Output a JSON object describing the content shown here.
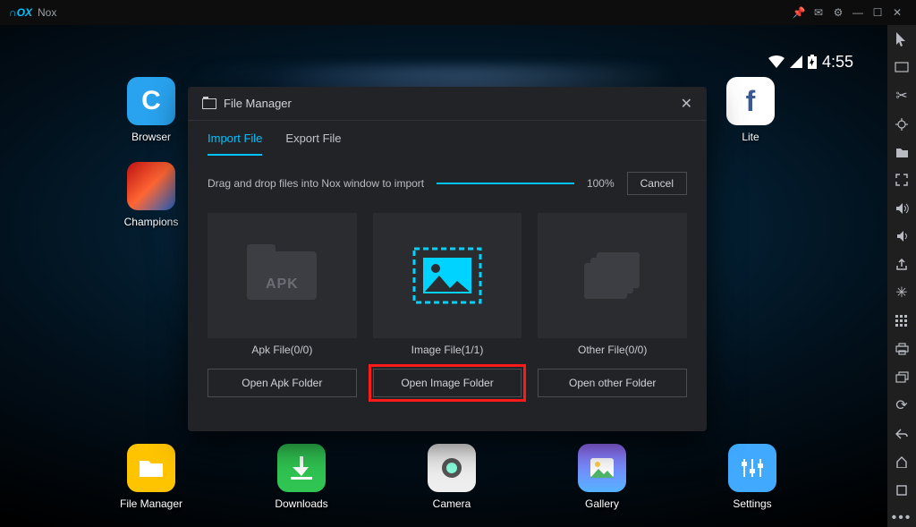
{
  "app": {
    "name": "Nox"
  },
  "status": {
    "time": "4:55"
  },
  "desktop": {
    "browser": "Browser",
    "lite": "Lite",
    "champions": "Champions",
    "filemgr": "File Manager",
    "downloads": "Downloads",
    "camera": "Camera",
    "gallery": "Gallery",
    "settings": "Settings"
  },
  "modal": {
    "title": "File Manager",
    "tabs": {
      "import": "Import File",
      "export": "Export File"
    },
    "drop_hint": "Drag and drop files into Nox window to import",
    "progress_pct": "100%",
    "cancel": "Cancel",
    "cards": {
      "apk": {
        "label": "Apk File(0/0)",
        "glyph": "APK",
        "open": "Open Apk Folder"
      },
      "image": {
        "label": "Image File(1/1)",
        "open": "Open Image Folder"
      },
      "other": {
        "label": "Other File(0/0)",
        "open": "Open other Folder"
      }
    }
  }
}
